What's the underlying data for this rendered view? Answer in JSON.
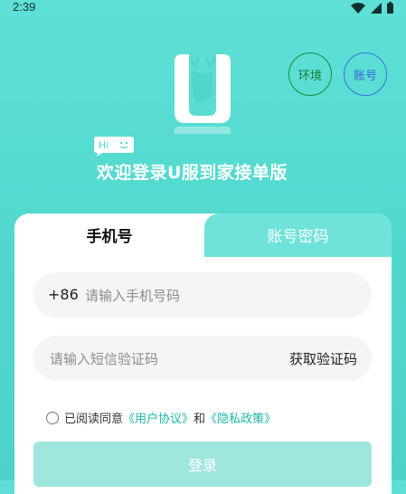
{
  "status_bar": {
    "time": "2:39"
  },
  "header": {
    "env_label": "环境",
    "account_label": "账号",
    "hi_text": "Hi",
    "welcome_title": "欢迎登录U服到家接单版"
  },
  "tabs": [
    {
      "label": "手机号",
      "active": true
    },
    {
      "label": "账号密码",
      "active": false
    }
  ],
  "phone_form": {
    "prefix": "+86",
    "phone_placeholder": "请输入手机号码",
    "code_placeholder": "请输入短信验证码",
    "get_code_label": "获取验证码"
  },
  "agreement": {
    "prefix": "已阅读同意",
    "user_agreement": "《用户协议》",
    "and": "和",
    "privacy_policy": "《隐私政策》",
    "checked": false
  },
  "login_button": "登录",
  "colors": {
    "background": "#4fd7cc",
    "accent": "#1ab9a4",
    "env_border": "#1a8a3a",
    "account_border": "#3a6fe0"
  }
}
